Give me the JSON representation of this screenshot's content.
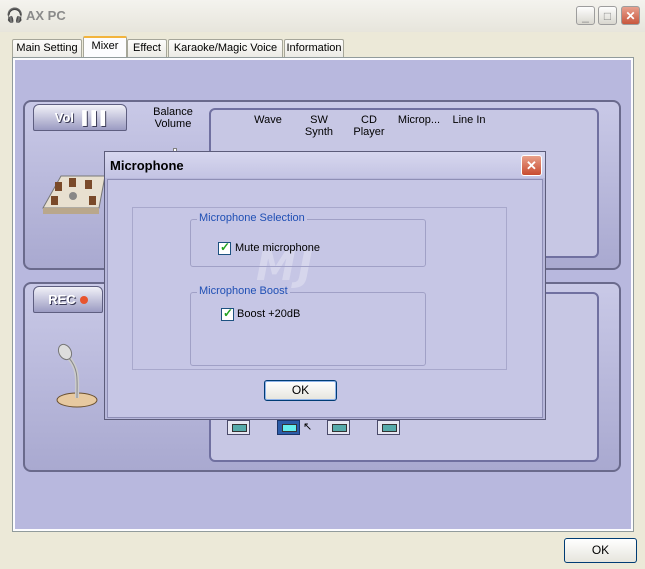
{
  "window": {
    "title": "AX PC",
    "icon": "headphones-icon",
    "minimize": "_",
    "maximize": "□",
    "close": "✕"
  },
  "tabs": [
    "Main Setting",
    "Mixer",
    "Effect",
    "Karaoke/Magic Voice",
    "Information"
  ],
  "active_tab": "Mixer",
  "mixer": {
    "vol_badge": "Vol",
    "balance_label": "Balance Volume",
    "channels": [
      "Wave",
      "SW Synth",
      "CD Player",
      "Microp...",
      "Line In"
    ],
    "rec_badge": "REC"
  },
  "dialog": {
    "title": "Microphone",
    "close": "✕",
    "group1_title": "Microphone Selection",
    "mute_label": "Mute microphone",
    "mute_checked": true,
    "group2_title": "Microphone Boost",
    "boost_label": "Boost +20dB",
    "boost_checked": true,
    "ok_label": "OK",
    "watermark": "MJ"
  },
  "footer": {
    "ok_label": "OK"
  },
  "colors": {
    "panel": "#b8b8de",
    "group_title": "#1f4fb4",
    "check": "#21a121"
  }
}
